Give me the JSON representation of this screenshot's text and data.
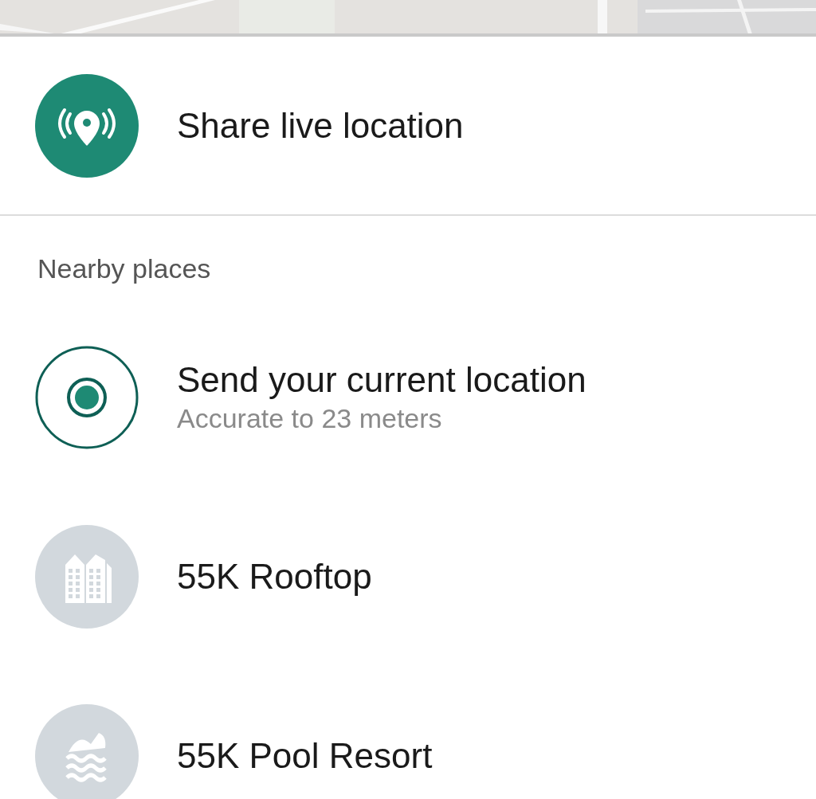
{
  "share": {
    "label": "Share live location"
  },
  "section_heading": "Nearby places",
  "items": [
    {
      "kind": "current",
      "title": "Send your current location",
      "subtitle": "Accurate to 23 meters"
    },
    {
      "kind": "place",
      "title": "55K Rooftop"
    },
    {
      "kind": "place",
      "title": "55K Pool Resort"
    }
  ]
}
